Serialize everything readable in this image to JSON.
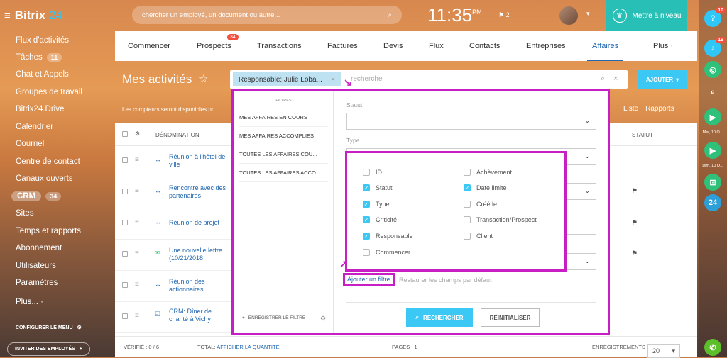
{
  "app": {
    "logo_a": "Bitrix",
    "logo_b": "24"
  },
  "search": {
    "placeholder": "chercher un employé, un document ou autre..."
  },
  "clock": {
    "time": "11:35",
    "ampm": "PM",
    "flag_count": "2"
  },
  "upgrade": {
    "label": "Mettre à niveau"
  },
  "sidebar": {
    "items": [
      {
        "label": "Flux d'activités"
      },
      {
        "label": "Tâches",
        "count": "11"
      },
      {
        "label": "Chat et Appels"
      },
      {
        "label": "Groupes de travail"
      },
      {
        "label": "Bitrix24.Drive"
      },
      {
        "label": "Calendrier"
      },
      {
        "label": "Courriel"
      },
      {
        "label": "Centre de contact"
      },
      {
        "label": "Canaux ouverts"
      },
      {
        "label": "CRM",
        "count": "34"
      },
      {
        "label": "Sites"
      },
      {
        "label": "Temps et rapports"
      },
      {
        "label": "Abonnement"
      },
      {
        "label": "Utilisateurs"
      },
      {
        "label": "Paramètres"
      },
      {
        "label": "Plus... ·"
      }
    ],
    "configure": "CONFIGURER LE MENU",
    "invite": "INVITER DES EMPLOYÉS"
  },
  "rightbar": {
    "badge1": "10",
    "badge2": "19",
    "date1": "Mer, 10 O...",
    "date2": "Dim, 10 O...",
    "b24": "24"
  },
  "tabs": {
    "items": [
      "Commencer",
      "Prospects",
      "Transactions",
      "Factures",
      "Devis",
      "Flux",
      "Contacts",
      "Entreprises",
      "Affaires",
      "Plus ·"
    ],
    "prospects_badge": "34"
  },
  "page": {
    "title": "Mes activités",
    "add": "AJOUTER",
    "counter_note": "Les compteurs seront disponibles pr",
    "view_list": "Liste",
    "view_reports": "Rapports"
  },
  "filterbar": {
    "chip": "Responsable: Julie Loba...",
    "placeholder": "recherche"
  },
  "grid": {
    "col_name": "DÉNOMINATION",
    "col_status": "STATUT",
    "rows": [
      {
        "text": "Réunion à l'hôtel de ville"
      },
      {
        "text": "Rencontre avec des partenaires"
      },
      {
        "text": "Réunion de projet"
      },
      {
        "text": "Une nouvelle lettre (10/21/2018"
      },
      {
        "text": "Réunion des actionnaires"
      },
      {
        "text": "CRM: Dîner de charité à Vichy"
      }
    ],
    "footer": {
      "verified": "VÉRIFIÉ : 0 / 6",
      "total": "TOTAL:",
      "show_qty": "AFFICHER LA QUANTITÉ",
      "pages": "PAGES : 1",
      "records": "ENREGISTREMENTS :",
      "per_page": "20"
    }
  },
  "filter_popup": {
    "list_title": "FILTRES",
    "presets": [
      "MES AFFAIRES EN COURS",
      "MES AFFAIRES ACCOMPLIES",
      "TOUTES LES AFFAIRES COU...",
      "TOUTES LES AFFAIRES ACCO..."
    ],
    "save": "ENREGISTRER LE FILTRE",
    "label_statut": "Statut",
    "label_type": "Type",
    "fields_left": [
      {
        "label": "ID",
        "checked": false
      },
      {
        "label": "Statut",
        "checked": true
      },
      {
        "label": "Type",
        "checked": true
      },
      {
        "label": "Criticité",
        "checked": true
      },
      {
        "label": "Responsable",
        "checked": true
      },
      {
        "label": "Commencer",
        "checked": false
      }
    ],
    "fields_right": [
      {
        "label": "Achèvement",
        "checked": false
      },
      {
        "label": "Date limite",
        "checked": true
      },
      {
        "label": "Créé le",
        "checked": false
      },
      {
        "label": "Transaction/Prospect",
        "checked": false
      },
      {
        "label": "Client",
        "checked": false
      }
    ],
    "add_filter": "Ajouter un filtre",
    "restore": "Restaurer les champs par défaut",
    "search_btn": "RECHERCHER",
    "reset_btn": "RÉINITIALISER"
  },
  "colors": {
    "accent": "#3bc8f5",
    "highlight": "#c81fc4",
    "link": "#2067b0",
    "upgrade": "#28c0b6"
  }
}
